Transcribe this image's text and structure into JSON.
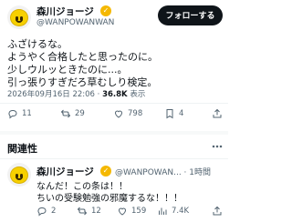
{
  "tweet": {
    "author_name": "森川ジョージ",
    "handle": "@WANPOWANWAN",
    "follow_label": "フォローする",
    "lines": [
      "ふざけるな。",
      "ようやく合格したと思ったのに。",
      "少しウルッときたのに...。",
      "引っ張りすぎだろ草むしり検定。"
    ],
    "timestamp": "2026年09月16日 22:06",
    "separator": "·",
    "views_count": "36.8K",
    "views_label": "表示",
    "actions": {
      "replies": "11",
      "retweets": "29",
      "likes": "798",
      "bookmarks": "4"
    }
  },
  "related": {
    "title": "関連性",
    "author_name": "森川ジョージ",
    "handle_time": "@WANPOWAN... · 1時間",
    "lines": [
      "なんだ！この条は！！",
      "ちいの受験勉強の邪魔するな！！！"
    ],
    "actions": {
      "replies": "2",
      "retweets": "12",
      "likes": "159",
      "views": "7.4K"
    }
  },
  "colors": {
    "text": "#0f1419",
    "muted": "#536471",
    "verified": "#f5b800",
    "button": "#0f1419"
  }
}
